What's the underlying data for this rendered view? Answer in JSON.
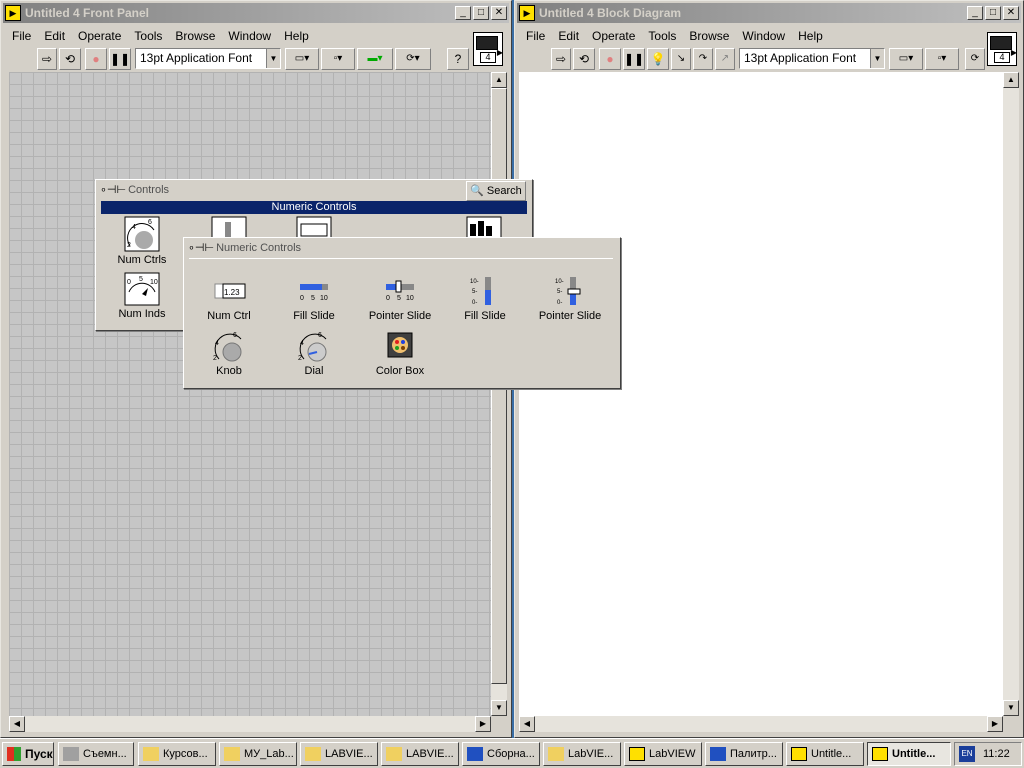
{
  "front_panel": {
    "title": "Untitled 4 Front Panel",
    "menu": [
      "File",
      "Edit",
      "Operate",
      "Tools",
      "Browse",
      "Window",
      "Help"
    ],
    "font_ring": "13pt Application Font",
    "connector_number": "4",
    "help_glyph": "?"
  },
  "block_diagram": {
    "title": "Untitled 4 Block Diagram",
    "menu": [
      "File",
      "Edit",
      "Operate",
      "Tools",
      "Browse",
      "Window",
      "Help"
    ],
    "font_ring": "13pt Application Font",
    "connector_number": "4"
  },
  "controls_palette": {
    "title": "Controls",
    "search_label": "Search",
    "selected_category": "Numeric Controls",
    "items": [
      {
        "label": "Num Ctrls",
        "icon": "knob-gauge-icon"
      },
      {
        "label": "Num Inds",
        "icon": "meter-icon"
      }
    ]
  },
  "numeric_palette": {
    "title": "Numeric Controls",
    "items": [
      {
        "label": "Num Ctrl",
        "icon": "numeric-control-icon"
      },
      {
        "label": "Fill Slide",
        "icon": "horizontal-fill-slide-icon"
      },
      {
        "label": "Pointer Slide",
        "icon": "horizontal-pointer-slide-icon"
      },
      {
        "label": "Fill Slide",
        "icon": "vertical-fill-slide-icon"
      },
      {
        "label": "Pointer Slide",
        "icon": "vertical-pointer-slide-icon"
      },
      {
        "label": "Knob",
        "icon": "knob-icon"
      },
      {
        "label": "Dial",
        "icon": "dial-icon"
      },
      {
        "label": "Color Box",
        "icon": "color-box-icon"
      }
    ],
    "num_ctrl_value": "1.23",
    "slide_scale": [
      "0",
      "5",
      "10"
    ],
    "vertical_scale": [
      "10-",
      "5-",
      "0-"
    ],
    "knob_scale": [
      "2",
      "4",
      "6"
    ]
  },
  "taskbar": {
    "start_label": "Пуск",
    "buttons": [
      {
        "label": "Съемн...",
        "icon": "drive-icon"
      },
      {
        "label": "Курсов...",
        "icon": "folder-icon"
      },
      {
        "label": "МУ_Lab...",
        "icon": "folder-icon"
      },
      {
        "label": "LABVIE...",
        "icon": "folder-icon"
      },
      {
        "label": "LABVIE...",
        "icon": "folder-icon"
      },
      {
        "label": "Сборна...",
        "icon": "word-icon"
      },
      {
        "label": "LabVIE...",
        "icon": "folder-icon"
      },
      {
        "label": "LabVIEW",
        "icon": "labview-icon"
      },
      {
        "label": "Палитр...",
        "icon": "word-icon"
      },
      {
        "label": "Untitle...",
        "icon": "labview-icon"
      },
      {
        "label": "Untitle...",
        "icon": "labview-icon"
      }
    ],
    "lang": "EN",
    "clock": "11:22"
  },
  "colors": {
    "active_title": "#0a246a",
    "inactive_title": "#808080",
    "palette_highlight": "#0a246a",
    "face": "#d4d0c8"
  }
}
